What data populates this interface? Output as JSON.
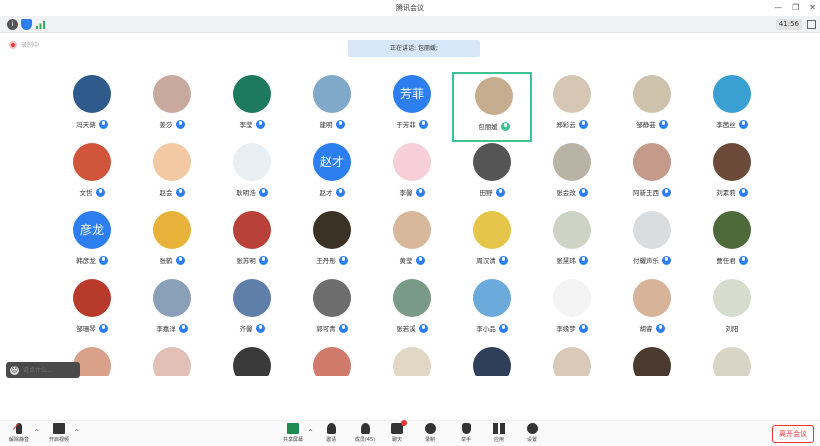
{
  "window": {
    "title": "腾讯会议",
    "minimize": "—",
    "restore": "❐",
    "close": "✕"
  },
  "status": {
    "timer": "41:56"
  },
  "recording": {
    "label": "录制中"
  },
  "speaking": {
    "label": "正在讲话: 包丽媛;"
  },
  "colors": {
    "accent": "#2d7ff0",
    "speaking_border": "#3ec28f",
    "leave": "#e33333"
  },
  "participants": [
    {
      "name": "冯天蒴",
      "avatar_text": "",
      "color": "#2f5b8c",
      "mic": "muted"
    },
    {
      "name": "姜莎",
      "avatar_text": "",
      "color": "#c7a99e",
      "mic": "muted"
    },
    {
      "name": "李莹",
      "avatar_text": "",
      "color": "#1e7a5c",
      "mic": "muted"
    },
    {
      "name": "建明",
      "avatar_text": "",
      "color": "#7fa8c9",
      "mic": "muted"
    },
    {
      "name": "于芳菲",
      "avatar_text": "芳菲",
      "color": "#2d7ff0",
      "mic": "muted"
    },
    {
      "name": "包丽媛",
      "avatar_text": "",
      "color": "#c6ad8f",
      "mic": "on"
    },
    {
      "name": "郑彩云",
      "avatar_text": "",
      "color": "#d6c7b5",
      "mic": "muted"
    },
    {
      "name": "邹静芸",
      "avatar_text": "",
      "color": "#cfc2ad",
      "mic": "muted"
    },
    {
      "name": "李茜丝",
      "avatar_text": "",
      "color": "#3a9fd1",
      "mic": "muted"
    },
    {
      "name": "文哲",
      "avatar_text": "",
      "color": "#d0553a",
      "mic": "muted"
    },
    {
      "name": "赵会",
      "avatar_text": "",
      "color": "#f3c9a4",
      "mic": "muted"
    },
    {
      "name": "耿明浩",
      "avatar_text": "",
      "color": "#e9eef2",
      "mic": "muted"
    },
    {
      "name": "赵才",
      "avatar_text": "赵才",
      "color": "#2d7ff0",
      "mic": "muted"
    },
    {
      "name": "李馨",
      "avatar_text": "",
      "color": "#f6cfd8",
      "mic": "muted"
    },
    {
      "name": "田野",
      "avatar_text": "",
      "color": "#555555",
      "mic": "muted"
    },
    {
      "name": "张会改",
      "avatar_text": "",
      "color": "#b9b3a5",
      "mic": "muted"
    },
    {
      "name": "阿新王西",
      "avatar_text": "",
      "color": "#c49a8a",
      "mic": "muted"
    },
    {
      "name": "刘素莉",
      "avatar_text": "",
      "color": "#6b4a3a",
      "mic": "muted"
    },
    {
      "name": "韩彦龙",
      "avatar_text": "彦龙",
      "color": "#2d7ff0",
      "mic": "muted"
    },
    {
      "name": "张鹤",
      "avatar_text": "",
      "color": "#e8b23a",
      "mic": "muted"
    },
    {
      "name": "张苏明",
      "avatar_text": "",
      "color": "#b8423a",
      "mic": "muted"
    },
    {
      "name": "王丹彤",
      "avatar_text": "",
      "color": "#3b3226",
      "mic": "muted"
    },
    {
      "name": "黄莹",
      "avatar_text": "",
      "color": "#d8b89a",
      "mic": "muted"
    },
    {
      "name": "周汉清",
      "avatar_text": "",
      "color": "#e6c64a",
      "mic": "muted"
    },
    {
      "name": "张慧玮",
      "avatar_text": "",
      "color": "#cfd3c6",
      "mic": "muted"
    },
    {
      "name": "付耀声乐",
      "avatar_text": "",
      "color": "#d9dde0",
      "mic": "muted"
    },
    {
      "name": "曹任君",
      "avatar_text": "",
      "color": "#4e6a3a",
      "mic": "muted"
    },
    {
      "name": "邹珊琴",
      "avatar_text": "",
      "color": "#b83a2a",
      "mic": "muted"
    },
    {
      "name": "李嘉洋",
      "avatar_text": "",
      "color": "#8aa0b8",
      "mic": "muted"
    },
    {
      "name": "齐馨",
      "avatar_text": "",
      "color": "#5f7fa8",
      "mic": "muted"
    },
    {
      "name": "郭可青",
      "avatar_text": "",
      "color": "#6d6d6d",
      "mic": "muted"
    },
    {
      "name": "张若溪",
      "avatar_text": "",
      "color": "#7a9a88",
      "mic": "muted"
    },
    {
      "name": "李小品",
      "avatar_text": "",
      "color": "#6aa9d9",
      "mic": "muted"
    },
    {
      "name": "李缘梦",
      "avatar_text": "",
      "color": "#f4f4f4",
      "mic": "muted"
    },
    {
      "name": "胡睿",
      "avatar_text": "",
      "color": "#d7b39a",
      "mic": "muted"
    },
    {
      "name": "刘阳",
      "avatar_text": "",
      "color": "#d7dccd",
      "mic": "none"
    },
    {
      "name": "",
      "avatar_text": "",
      "color": "#d9a08a",
      "mic": "none"
    },
    {
      "name": "",
      "avatar_text": "",
      "color": "#e2c0b8",
      "mic": "none"
    },
    {
      "name": "",
      "avatar_text": "",
      "color": "#3a3a3a",
      "mic": "none"
    },
    {
      "name": "",
      "avatar_text": "",
      "color": "#cf7a6a",
      "mic": "none"
    },
    {
      "name": "",
      "avatar_text": "",
      "color": "#e2d7c4",
      "mic": "none"
    },
    {
      "name": "",
      "avatar_text": "",
      "color": "#2f3f5a",
      "mic": "none"
    },
    {
      "name": "",
      "avatar_text": "",
      "color": "#d9c9b9",
      "mic": "none"
    },
    {
      "name": "",
      "avatar_text": "",
      "color": "#4a3a2f",
      "mic": "none"
    },
    {
      "name": "",
      "avatar_text": "",
      "color": "#d8d4c6",
      "mic": "none"
    }
  ],
  "chat": {
    "placeholder": "说点什么..."
  },
  "toolbar": {
    "unmute": "解除静音",
    "video": "开启视频",
    "share": "共享屏幕",
    "invite": "邀请",
    "members": "成员(45)",
    "chat": "聊天",
    "record": "录制",
    "raise_hand": "举手",
    "apps": "应用",
    "settings": "设置",
    "leave": "离开会议"
  }
}
